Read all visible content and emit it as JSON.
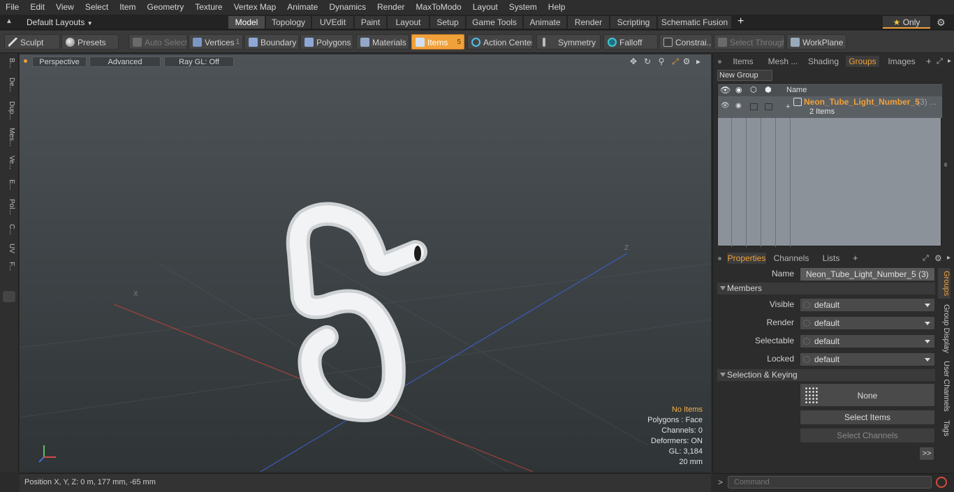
{
  "menu": [
    "File",
    "Edit",
    "View",
    "Select",
    "Item",
    "Geometry",
    "Texture",
    "Vertex Map",
    "Animate",
    "Dynamics",
    "Render",
    "MaxToModo",
    "Layout",
    "System",
    "Help"
  ],
  "layoutbar": {
    "layouts_label": "Default Layouts",
    "tabs": [
      "Model",
      "Topology",
      "UVEdit",
      "Paint",
      "Layout",
      "Setup",
      "Game Tools",
      "Animate",
      "Render",
      "Scripting",
      "Schematic Fusion"
    ],
    "active_tab": "Model",
    "add_tab": "+",
    "only_label": "Only"
  },
  "toolbar": {
    "sculpt": "Sculpt",
    "presets": "Presets",
    "auto_select": "Auto Select",
    "vertices": "Vertices",
    "vertices_count": "1",
    "boundary": "Boundary",
    "polygons": "Polygons",
    "materials": "Materials",
    "items": "Items",
    "items_count": "5",
    "action_center": "Action Center",
    "symmetry": "Symmetry",
    "falloff": "Falloff",
    "constraints": "Constrai...",
    "select_through": "Select Through",
    "workplane": "WorkPlane"
  },
  "left_tabs": [
    "B...",
    "De...",
    "Dup...",
    "Mes...",
    "Ve...",
    "E...",
    "Pol...",
    "C...",
    "UV",
    "F..."
  ],
  "viewport": {
    "perspective": "Perspective",
    "advanced": "Advanced",
    "raygl": "Ray GL: Off",
    "axis_x": "X",
    "axis_z": "Z",
    "info": {
      "no_items": "No Items",
      "polygons": "Polygons : Face",
      "channels": "Channels: 0",
      "deformers": "Deformers: ON",
      "gl": "GL: 3,184",
      "scale": "20 mm"
    }
  },
  "status": {
    "position": "Position X, Y, Z:   0 m, 177 mm, -65 mm"
  },
  "right_tabs": [
    "Items",
    "Mesh ...",
    "Shading",
    "Groups",
    "Images"
  ],
  "right_active_tab": "Groups",
  "new_group": "New Group",
  "group_list": {
    "header_name": "Name",
    "item_name": "Neon_Tube_Light_Number_5",
    "item_suffix": "(3) ...",
    "item_sub": "2 Items"
  },
  "props_tabs": [
    "Properties",
    "Channels",
    "Lists"
  ],
  "props_active": "Properties",
  "properties": {
    "name_label": "Name",
    "name_value": "Neon_Tube_Light_Number_5 (3)",
    "members": "Members",
    "visible_label": "Visible",
    "visible_value": "default",
    "render_label": "Render",
    "render_value": "default",
    "selectable_label": "Selectable",
    "selectable_value": "default",
    "locked_label": "Locked",
    "locked_value": "default",
    "selection_keying": "Selection & Keying",
    "none": "None",
    "select_items": "Select Items",
    "select_channels": "Select Channels",
    "more": ">>"
  },
  "right_vtabs": [
    "Groups",
    "Group Display",
    "User Channels",
    "Tags"
  ],
  "command_placeholder": "Command",
  "colors": {
    "accent": "#f0a13a",
    "axis_red": "#c0392b",
    "axis_blue": "#3f5fd0"
  }
}
